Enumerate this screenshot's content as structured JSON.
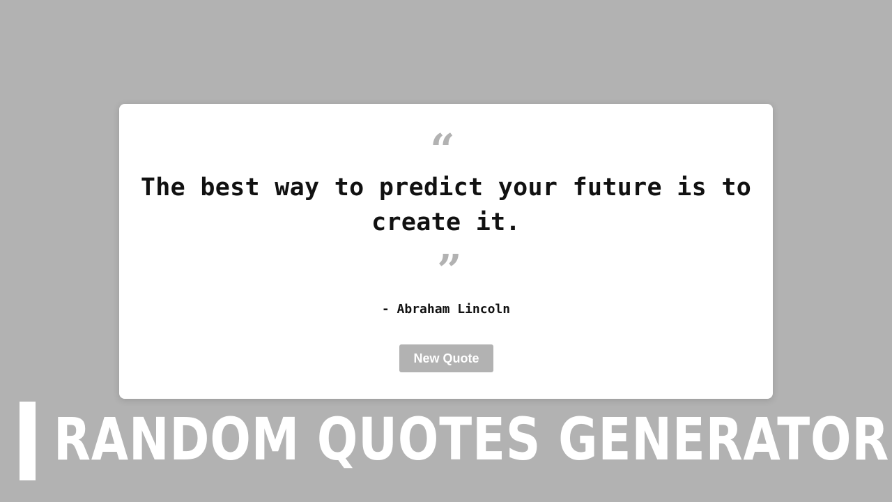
{
  "card": {
    "open_quote": "“",
    "close_quote": "”",
    "quote_text": "The best way to predict your future is to create it.",
    "author": "- Abraham Lincoln",
    "button_label": "New Quote"
  },
  "banner": {
    "title": "RANDOM QUOTES GENERATOR"
  },
  "colors": {
    "background": "#b2b2b2",
    "card": "#ffffff",
    "accent": "#b2b2b2",
    "text": "#111111"
  }
}
